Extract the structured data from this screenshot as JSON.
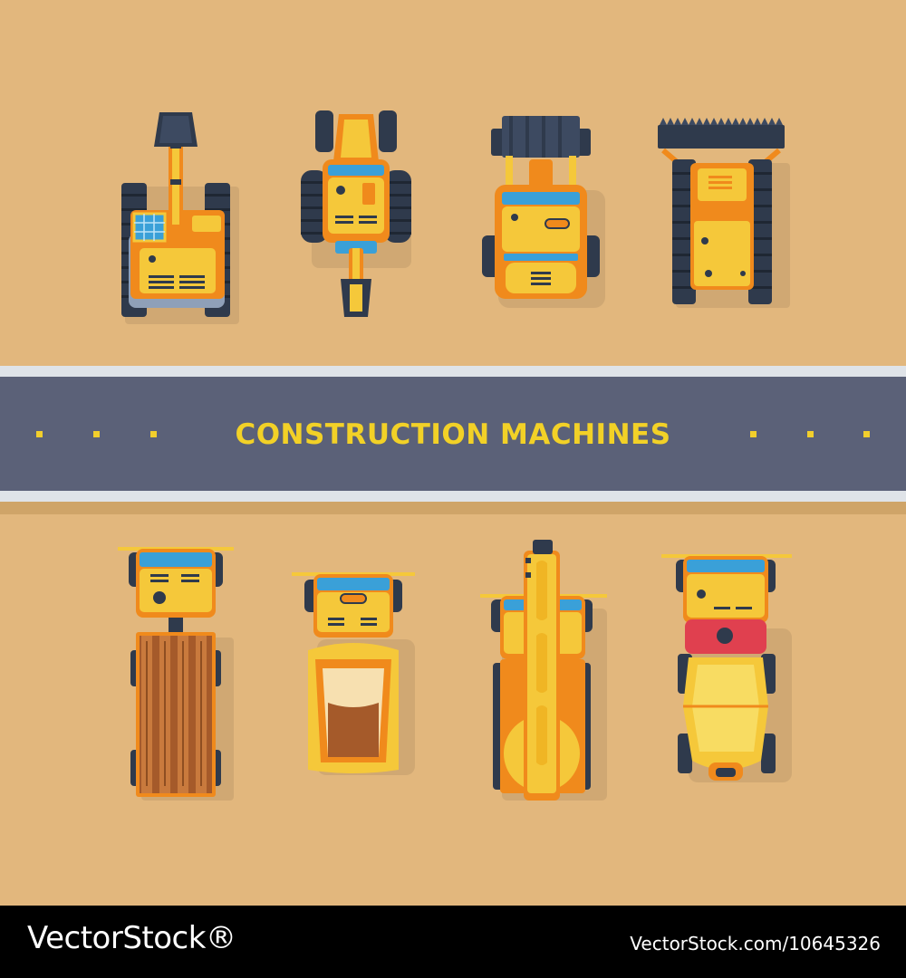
{
  "banner": {
    "title": "CONSTRUCTION MACHINES"
  },
  "footer": {
    "logo": "VectorStock®",
    "image_id": "VectorStock.com/10645326"
  },
  "machines": [
    {
      "name": "excavator-icon"
    },
    {
      "name": "backhoe-loader-icon"
    },
    {
      "name": "front-loader-icon"
    },
    {
      "name": "bulldozer-icon"
    },
    {
      "name": "timber-truck-icon"
    },
    {
      "name": "dump-truck-icon"
    },
    {
      "name": "crane-truck-icon"
    },
    {
      "name": "concrete-mixer-truck-icon"
    }
  ],
  "colors": {
    "sand": "#e2b77d",
    "road": "#5b6178",
    "road_edge": "#dfe3e8",
    "title": "#f2d127",
    "yellow": "#f5c83a",
    "orange": "#f08a1c",
    "track": "#2f3a4c",
    "glass": "#3aa0d8"
  }
}
